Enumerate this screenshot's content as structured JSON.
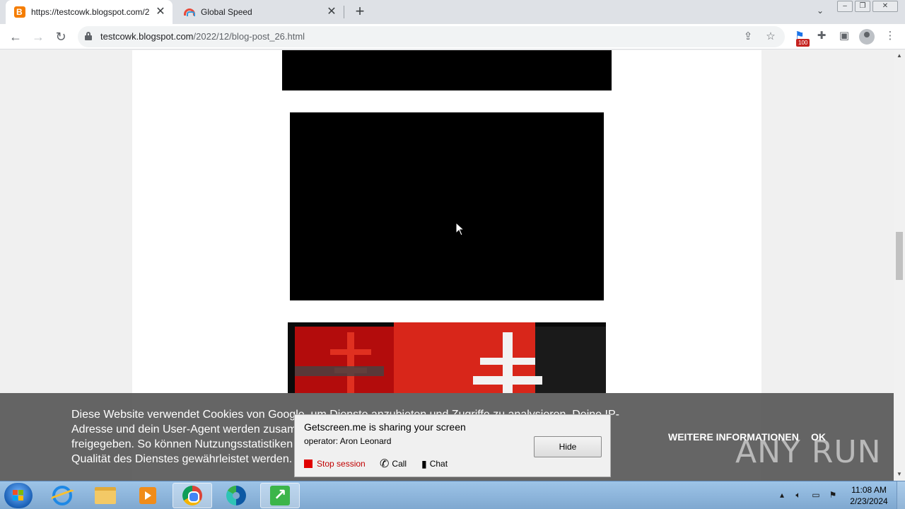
{
  "browser": {
    "tabs": [
      {
        "title": "https://testcowk.blogspot.com/2",
        "favicon": "blogger-icon",
        "active": true
      },
      {
        "title": "Global Speed",
        "favicon": "rainbow-icon",
        "active": false
      }
    ],
    "url_host": "testcowk.blogspot.com",
    "url_path": "/2022/12/blog-post_26.html",
    "extension_badge": "100"
  },
  "cookie": {
    "text": "Diese Website verwendet Cookies von Google, um Dienste anzubieten und Zugriffe zu analysieren. Deine IP-Adresse und dein User-Agent werden zusammen mit Messwerten zur Leistung und Sicherheit für Google freigegeben. So können Nutzungsstatistiken generiert, Missbrauchsfälle erkannt und behoben und die Qualität des Dienstes gewährleistet werden.",
    "more_info": "WEITERE INFORMATIONEN",
    "ok": "OK"
  },
  "getscreen": {
    "title": "Getscreen.me is sharing your screen",
    "operator": "operator: Aron Leonard",
    "hide": "Hide",
    "stop": "Stop session",
    "call": "Call",
    "chat": "Chat"
  },
  "watermark": "ANY RUN",
  "taskbar": {
    "time": "11:08 AM",
    "date": "2/23/2024"
  }
}
